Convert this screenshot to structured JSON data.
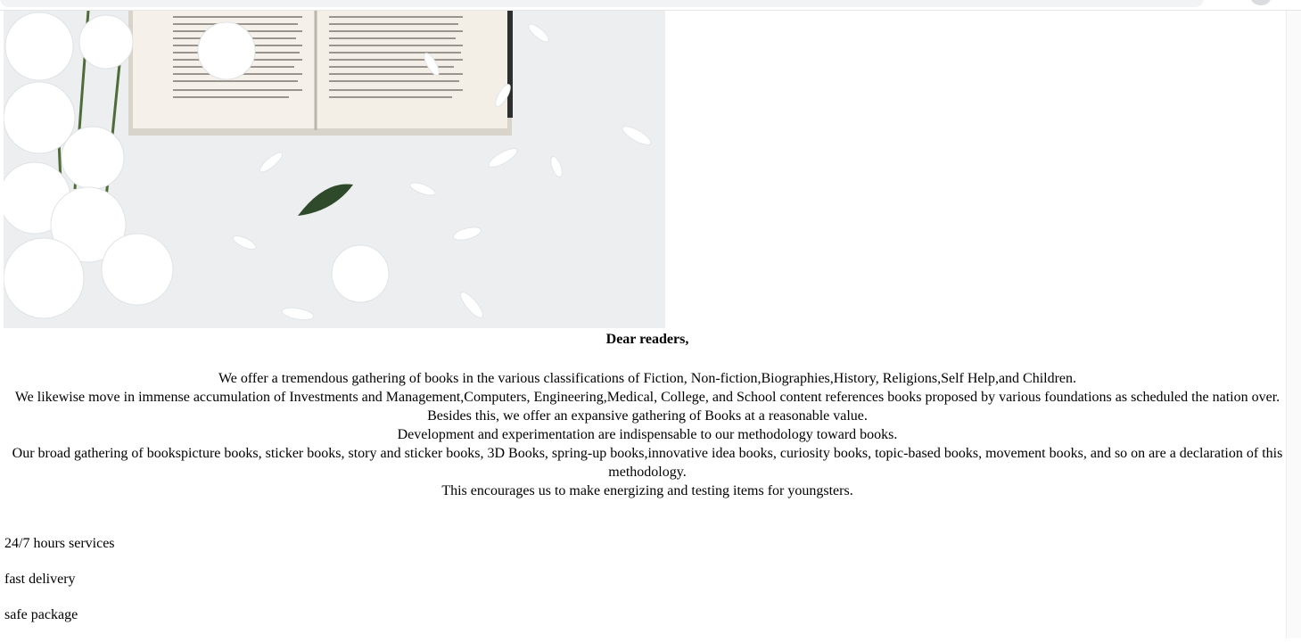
{
  "hero": {
    "alt": "open book with white chrysanthemum flowers and petals"
  },
  "greeting": "Dear readers,",
  "intro_lines": [
    "We offer a tremendous gathering of books in the various classifications of Fiction, Non-fiction,Biographies,History, Religions,Self Help,and Children.",
    "We likewise move in immense accumulation of Investments and Management,Computers, Engineering,Medical, College, and School content references books proposed by various foundations as scheduled the nation over.",
    "Besides this, we offer an expansive gathering of Books at a reasonable value.",
    "Development and experimentation are indispensable to our methodology toward books.",
    "Our broad gathering of bookspicture books, sticker books, story and sticker books, 3D Books, spring-up books,innovative idea books, curiosity books, topic-based books, movement books, and so on are a declaration of this methodology.",
    "This encourages us to make energizing and testing items for youngsters."
  ],
  "features": [
    "24/7 hours services",
    "fast delivery",
    "safe package"
  ]
}
